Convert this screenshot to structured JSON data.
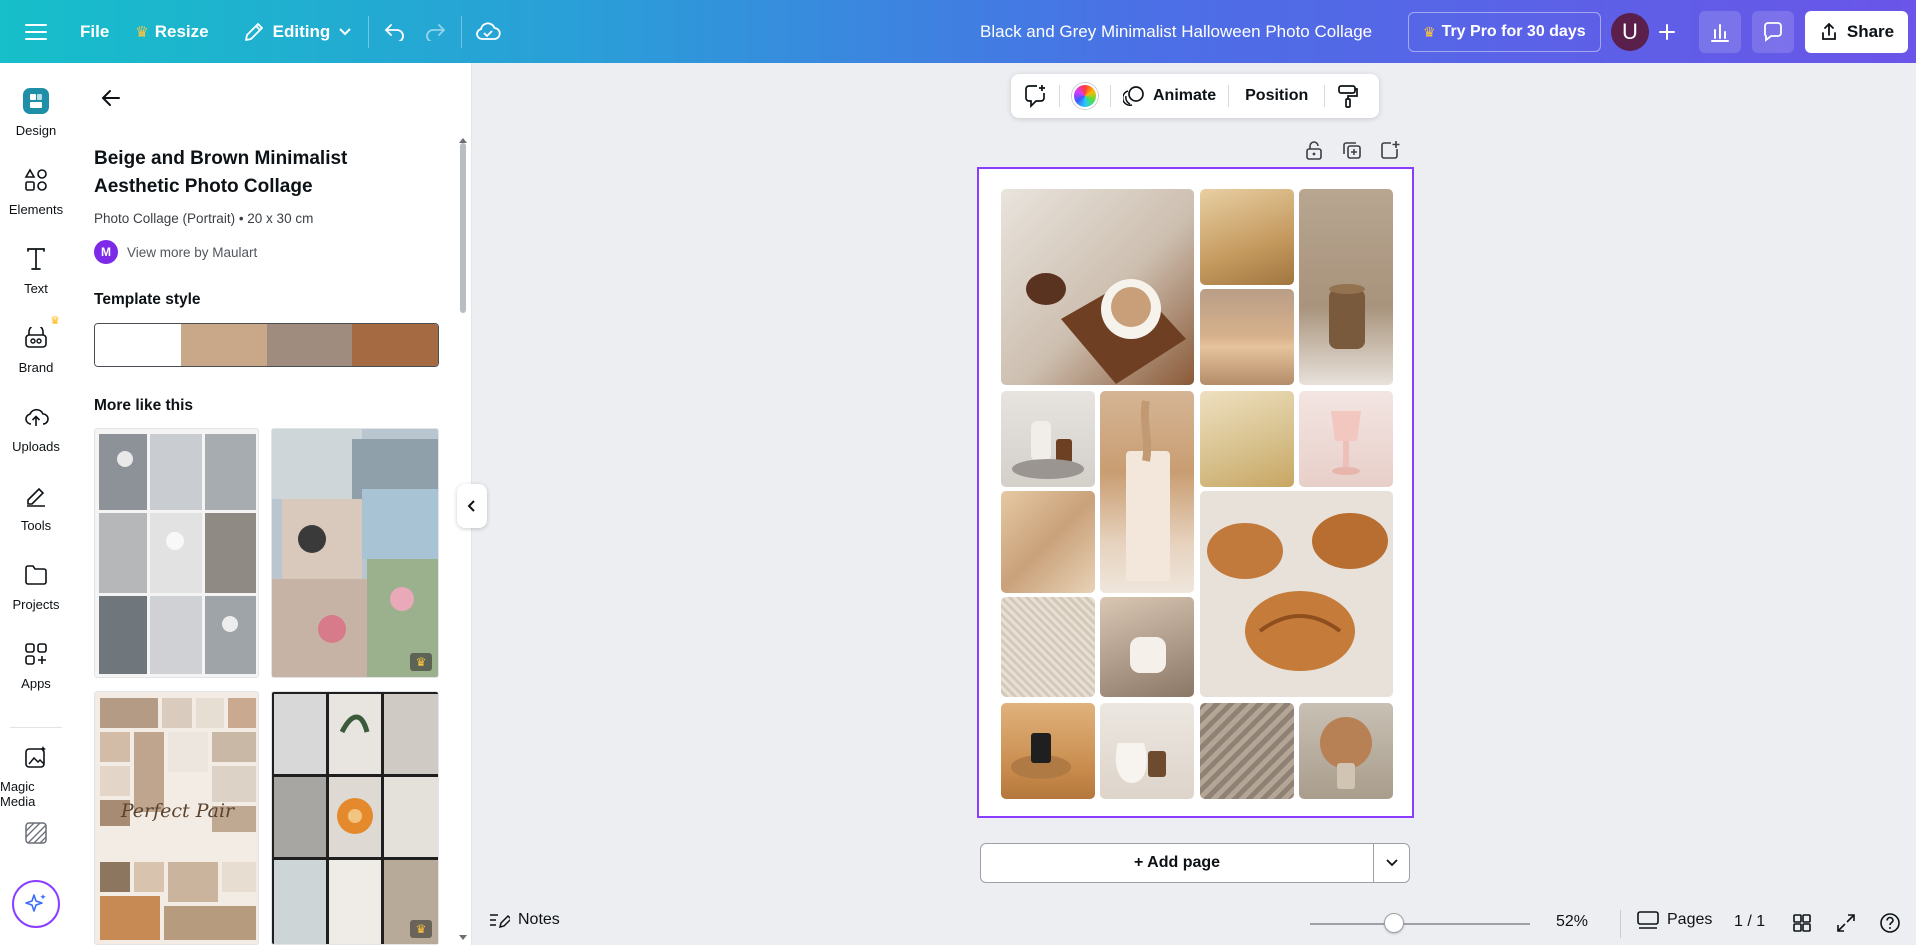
{
  "topbar": {
    "file_label": "File",
    "resize_label": "Resize",
    "editing_label": "Editing",
    "doc_title": "Black and Grey Minimalist Halloween Photo Collage",
    "try_pro_label": "Try Pro for 30 days",
    "avatar_initial": "U",
    "share_label": "Share",
    "crown_glyph": "♛"
  },
  "rail": {
    "items": [
      {
        "label": "Design",
        "icon": "design-icon"
      },
      {
        "label": "Elements",
        "icon": "elements-icon"
      },
      {
        "label": "Text",
        "icon": "text-icon"
      },
      {
        "label": "Brand",
        "icon": "brand-icon"
      },
      {
        "label": "Uploads",
        "icon": "uploads-icon"
      },
      {
        "label": "Tools",
        "icon": "tools-icon"
      },
      {
        "label": "Projects",
        "icon": "projects-icon"
      },
      {
        "label": "Apps",
        "icon": "apps-icon"
      },
      {
        "label": "Magic Media",
        "icon": "magic-media-icon"
      }
    ]
  },
  "panel": {
    "template_title": "Beige and Brown Minimalist Aesthetic Photo Collage",
    "template_subtitle": "Photo Collage (Portrait) • 20 x 30 cm",
    "author_initial": "M",
    "author_link": "View more by Maulart",
    "style_heading": "Template style",
    "style_colors": [
      "#ffffff",
      "#c9a88a",
      "#a08c7e",
      "#a56a42"
    ],
    "more_heading": "More like this",
    "thumb_text": "Perfect Pair"
  },
  "float_toolbar": {
    "animate_label": "Animate",
    "position_label": "Position"
  },
  "canvas": {
    "add_page_label": "+ Add page"
  },
  "bottombar": {
    "notes_label": "Notes",
    "zoom_label": "52%",
    "zoom_fraction": 0.38,
    "pages_label": "Pages",
    "page_count": "1 / 1"
  },
  "colors": {
    "accent": "#8b3dff",
    "topbar_start": "#16bfc9",
    "topbar_end": "#6a55e8"
  }
}
